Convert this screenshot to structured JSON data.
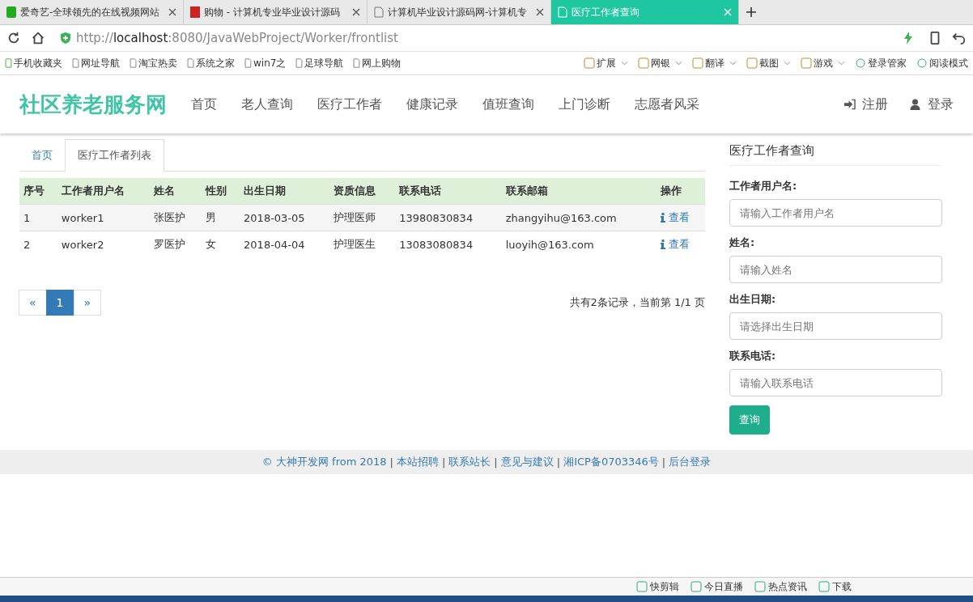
{
  "browser": {
    "tabs": [
      {
        "title": "爱奇艺-全球领先的在线视频网站",
        "selected": false,
        "kind": "video"
      },
      {
        "title": "购物 - 计算机专业毕业设计源码",
        "selected": false,
        "kind": "shop"
      },
      {
        "title": "计算机毕业设计源码网-计算机专",
        "selected": false,
        "kind": "page"
      },
      {
        "title": "医疗工作者查询",
        "selected": true,
        "kind": "page"
      }
    ],
    "url": {
      "scheme": "http://",
      "host": "localhost",
      "path": ":8080/JavaWebProject/Worker/frontlist"
    },
    "bookmarks": [
      {
        "label": "手机收藏夹",
        "kind": "phone"
      },
      {
        "label": "网址导航",
        "kind": "page"
      },
      {
        "label": "淘宝热卖",
        "kind": "page"
      },
      {
        "label": "系统之家",
        "kind": "page"
      },
      {
        "label": "win7之",
        "kind": "page"
      },
      {
        "label": "足球导航",
        "kind": "page"
      },
      {
        "label": "网上购物",
        "kind": "page"
      }
    ],
    "tools": [
      "扩展",
      "网银",
      "翻译",
      "截图",
      "游戏"
    ],
    "tools_plain": [
      "登录管家",
      "阅读模式"
    ],
    "status": [
      "快剪辑",
      "今日直播",
      "热点资讯",
      "下载"
    ]
  },
  "site": {
    "brand": "社区养老服务网",
    "nav": [
      "首页",
      "老人查询",
      "医疗工作者",
      "健康记录",
      "值班查询",
      "上门诊断",
      "志愿者风采"
    ],
    "user_links": [
      {
        "label": "注册",
        "kind": "register"
      },
      {
        "label": "登录",
        "kind": "login"
      }
    ],
    "tabs": [
      {
        "label": "首页",
        "selected": false
      },
      {
        "label": "医疗工作者列表",
        "selected": true
      }
    ],
    "table": {
      "columns": [
        "序号",
        "工作者用户名",
        "姓名",
        "性别",
        "出生日期",
        "资质信息",
        "联系电话",
        "联系邮箱",
        "操作"
      ],
      "rows": [
        {
          "cells": [
            "1",
            "worker1",
            "张医护",
            "男",
            "2018-03-05",
            "护理医师",
            "13980830834",
            "zhangyihu@163.com"
          ],
          "action": "查看"
        },
        {
          "cells": [
            "2",
            "worker2",
            "罗医护",
            "女",
            "2018-04-04",
            "护理医生",
            "13083080834",
            "luoyih@163.com"
          ],
          "action": "查看"
        }
      ]
    },
    "pagination": {
      "prev": "«",
      "pages": [
        {
          "label": "1",
          "selected": true
        }
      ],
      "next": "»"
    },
    "summary": "共有2条记录，当前第 1/1 页",
    "search": {
      "title": "医疗工作者查询",
      "fields": [
        {
          "label": "工作者用户名:",
          "placeholder": "请输入工作者用户名"
        },
        {
          "label": "姓名:",
          "placeholder": "请输入姓名"
        },
        {
          "label": "出生日期:",
          "placeholder": "请选择出生日期"
        },
        {
          "label": "联系电话:",
          "placeholder": "请输入联系电话"
        }
      ],
      "button": "查询"
    },
    "footer": {
      "items": [
        "© 大神开发网 from 2018",
        "本站招聘",
        "联系站长",
        "意见与建议",
        "湘ICP备0703346号",
        "后台登录"
      ],
      "separator": "|"
    }
  }
}
